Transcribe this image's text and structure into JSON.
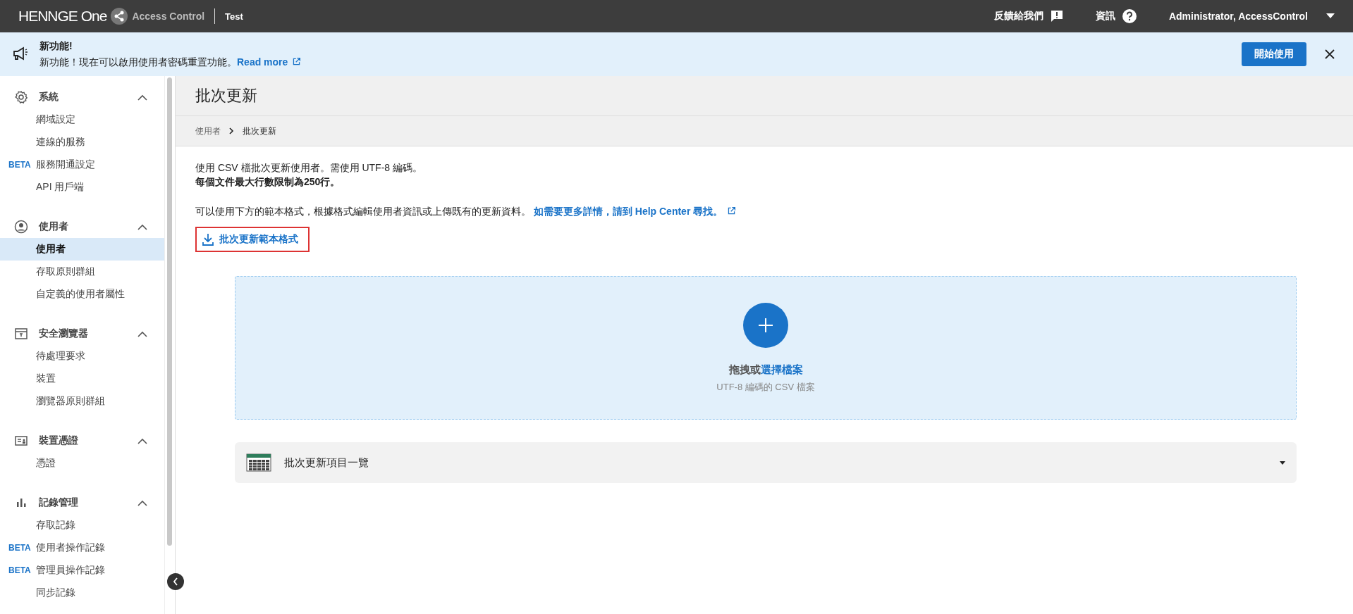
{
  "header": {
    "brand": "HENNGE One",
    "product": "Access Control",
    "tenant": "Test",
    "feedback": "反饋給我們",
    "info": "資訊",
    "user": "Administrator, AccessControl"
  },
  "banner": {
    "title": "新功能!",
    "message": "新功能！現在可以啟用使用者密碼重置功能。",
    "link": "Read more",
    "button": "開始使用"
  },
  "sidebar": {
    "sections": [
      {
        "kind": "gear",
        "title": "系統",
        "expanded": true,
        "items": [
          {
            "label": "網域設定",
            "selected": false
          },
          {
            "label": "連線的服務",
            "selected": false
          },
          {
            "label": "服務開通設定",
            "badge": "BETA",
            "selected": false
          },
          {
            "label": "API 用戶端",
            "selected": false
          }
        ]
      },
      {
        "kind": "person",
        "title": "使用者",
        "expanded": true,
        "items": [
          {
            "label": "使用者",
            "selected": true
          },
          {
            "label": "存取原則群組",
            "selected": false
          },
          {
            "label": "自定義的使用者屬性",
            "selected": false
          }
        ]
      },
      {
        "kind": "browser",
        "title": "安全瀏覽器",
        "expanded": true,
        "items": [
          {
            "label": "待處理要求",
            "selected": false
          },
          {
            "label": "裝置",
            "selected": false
          },
          {
            "label": "瀏覽器原則群組",
            "selected": false
          }
        ]
      },
      {
        "kind": "card",
        "title": "裝置憑證",
        "expanded": true,
        "items": [
          {
            "label": "憑證",
            "selected": false
          }
        ]
      },
      {
        "kind": "chart",
        "title": "記錄管理",
        "expanded": true,
        "items": [
          {
            "label": "存取記錄",
            "selected": false
          },
          {
            "label": "使用者操作記錄",
            "badge": "BETA",
            "selected": false
          },
          {
            "label": "管理員操作記錄",
            "badge": "BETA",
            "selected": false
          },
          {
            "label": "同步記錄",
            "selected": false
          }
        ]
      }
    ]
  },
  "page": {
    "title": "批次更新",
    "breadcrumb": [
      "使用者",
      "批次更新"
    ],
    "description": "使用 CSV 檔批次更新使用者。需使用 UTF-8 編碼。",
    "limit": "每個文件最大行數限制為250行。",
    "template_text": "可以使用下方的範本格式，根據格式編輯使用者資訊或上傳既有的更新資料。",
    "help_link": "如需要更多詳情，請到 Help Center 尋找。",
    "template_download": "批次更新範本格式",
    "dropzone": {
      "text": "拖拽或",
      "link": "選擇檔案",
      "hint": "UTF-8 編碼的 CSV 檔案"
    },
    "list": {
      "title": "批次更新項目一覽",
      "expanded": false
    }
  }
}
